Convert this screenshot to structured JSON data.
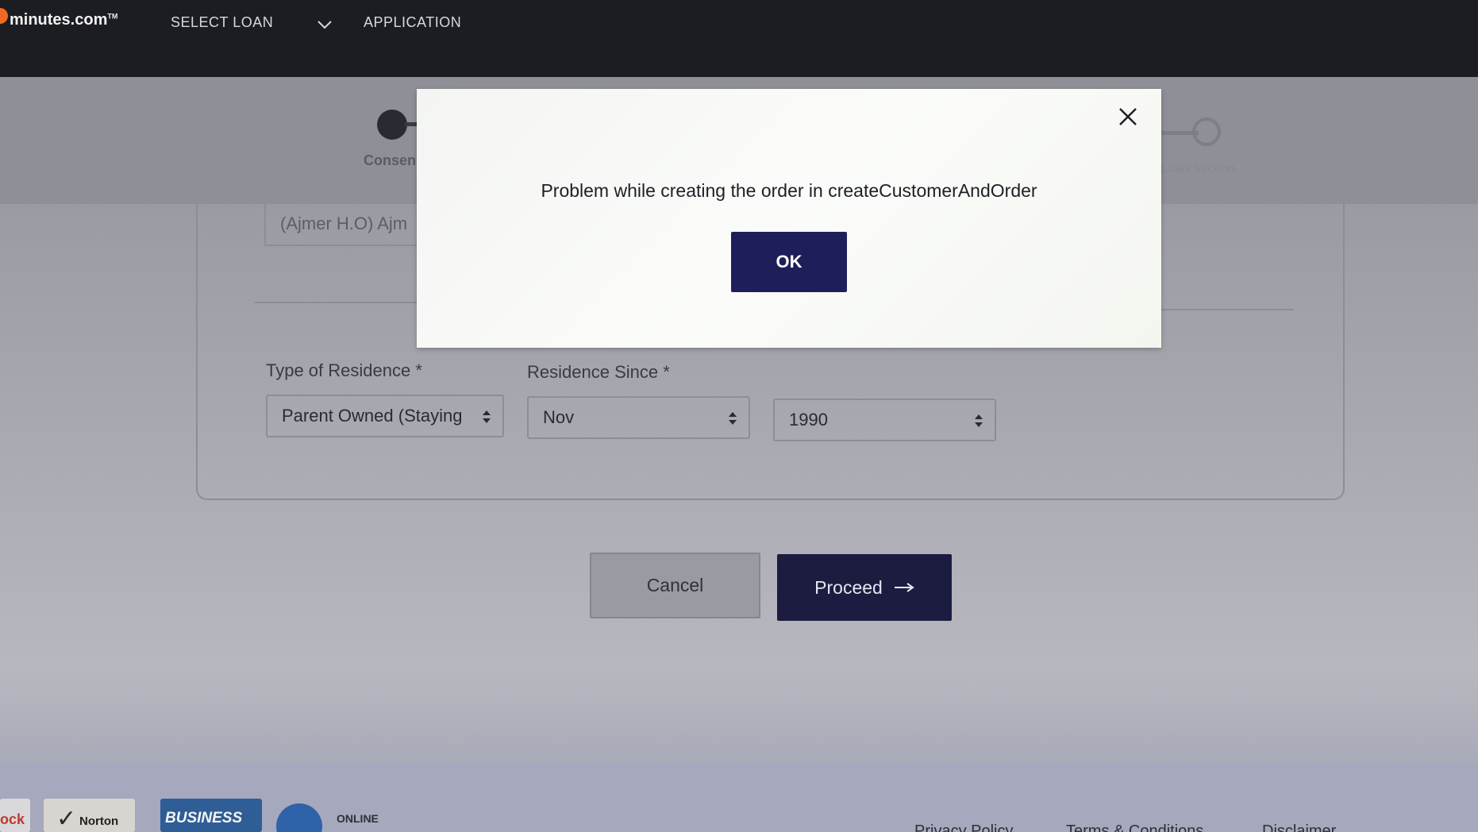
{
  "header": {
    "logo_text": "minutes.com",
    "logo_tm": "TM",
    "nav": {
      "select_loan": "SELECT LOAN",
      "application": "APPLICATION"
    }
  },
  "stepper": {
    "left_label": "Consen",
    "right_label": "Loan Section"
  },
  "form": {
    "address_value": "(Ajmer H.O) Ajm",
    "type_of_residence_label": "Type of Residence *",
    "type_of_residence_value": "Parent Owned (Staying",
    "residence_since_label": "Residence Since *",
    "residence_since_month": "Nov",
    "residence_since_year": "1990"
  },
  "actions": {
    "cancel_label": "Cancel",
    "proceed_label": "Proceed"
  },
  "modal": {
    "message": "Problem while creating the order in createCustomerAndOrder",
    "ok_label": "OK"
  },
  "footer": {
    "badges": {
      "lock_text": "ock",
      "norton_text": "Norton",
      "business_text": "BUSINESS",
      "online_text": "ONLINE"
    },
    "links": {
      "privacy": "Privacy Policy",
      "terms": "Terms & Conditions",
      "disclaimer": "Disclaimer"
    }
  },
  "colors": {
    "topbar_bg": "#1c1d22",
    "primary_button": "#1b1c40",
    "modal_ok": "#1e1f5a",
    "logo_accent": "#f26a21"
  },
  "icons": [
    "close-icon",
    "chevron-down-icon",
    "arrow-right-icon",
    "select-updown-icon",
    "checkmark-icon",
    "globe-icon"
  ]
}
